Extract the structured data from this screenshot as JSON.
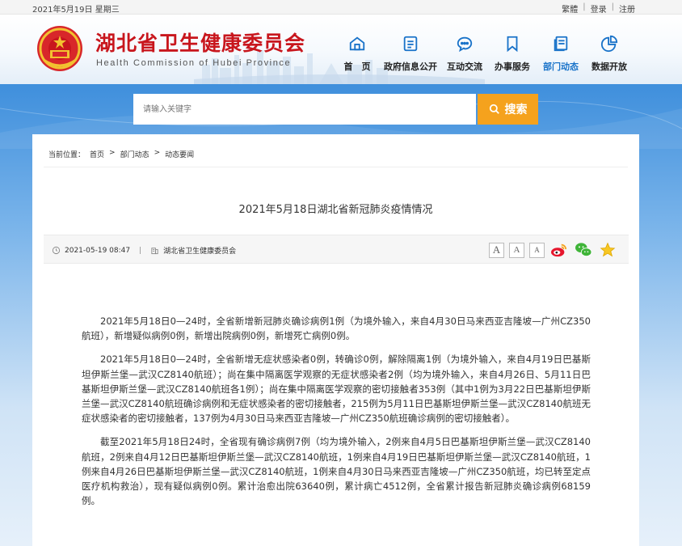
{
  "topbar": {
    "date": "2021年5月19日 星期三",
    "links": [
      "繁體",
      "登录",
      "注册"
    ]
  },
  "header": {
    "title_cn": "湖北省卫生健康委员会",
    "title_en": "Health Commission of Hubei Province",
    "nav": [
      {
        "label": "首　页",
        "icon": "home-icon"
      },
      {
        "label": "政府信息公开",
        "icon": "document-icon"
      },
      {
        "label": "互动交流",
        "icon": "chat-icon"
      },
      {
        "label": "办事服务",
        "icon": "bookmark-icon"
      },
      {
        "label": "部门动态",
        "icon": "news-icon",
        "active": true
      },
      {
        "label": "数据开放",
        "icon": "pie-chart-icon"
      }
    ]
  },
  "search": {
    "placeholder": "请输入关键字",
    "button_label": "搜索"
  },
  "breadcrumb": {
    "prefix": "当前位置：",
    "items": [
      "首页",
      "部门动态",
      "动态要闻"
    ],
    "sep": ">"
  },
  "article": {
    "title": "2021年5月18日湖北省新冠肺炎疫情情况",
    "datetime": "2021-05-19 08:47",
    "source": "湖北省卫生健康委员会",
    "font_buttons": [
      "A",
      "A",
      "A"
    ],
    "paragraphs": [
      "2021年5月18日0—24时，全省新增新冠肺炎确诊病例1例（为境外输入，来自4月30日马来西亚吉隆坡—广州CZ350航班），新增疑似病例0例，新增出院病例0例，新增死亡病例0例。",
      "2021年5月18日0—24时，全省新增无症状感染者0例，转确诊0例，解除隔离1例（为境外输入，来自4月19日巴基斯坦伊斯兰堡—武汉CZ8140航班）；尚在集中隔离医学观察的无症状感染者2例（均为境外输入，来自4月26日、5月11日巴基斯坦伊斯兰堡—武汉CZ8140航班各1例）；尚在集中隔离医学观察的密切接触者353例（其中1例为3月22日巴基斯坦伊斯兰堡—武汉CZ8140航班确诊病例和无症状感染者的密切接触者，215例为5月11日巴基斯坦伊斯兰堡—武汉CZ8140航班无症状感染者的密切接触者，137例为4月30日马来西亚吉隆坡—广州CZ350航班确诊病例的密切接触者）。",
      "截至2021年5月18日24时，全省现有确诊病例7例（均为境外输入，2例来自4月5日巴基斯坦伊斯兰堡—武汉CZ8140航班，2例来自4月12日巴基斯坦伊斯兰堡—武汉CZ8140航班，1例来自4月19日巴基斯坦伊斯兰堡—武汉CZ8140航班，1例来自4月26日巴基斯坦伊斯兰堡—武汉CZ8140航班，1例来自4月30日马来西亚吉隆坡—广州CZ350航班，均已转至定点医疗机构救治），现有疑似病例0例。累计治愈出院63640例，累计病亡4512例，全省累计报告新冠肺炎确诊病例68159例。"
    ]
  },
  "colors": {
    "brand_red": "#c8161d",
    "accent_blue": "#1a73c9",
    "search_orange": "#f5a21d"
  }
}
